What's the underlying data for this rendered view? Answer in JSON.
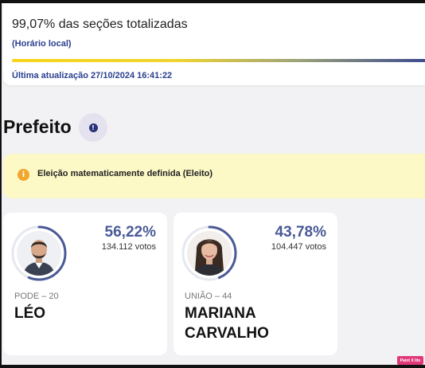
{
  "progress": {
    "title": "99,07% das seções totalizadas",
    "note": "(Horário local)",
    "percent": 99.07,
    "updated": "Última atualização 27/10/2024 16:41:22"
  },
  "section": {
    "title": "Prefeito",
    "info_icon": "info-icon",
    "info_glyph": "!"
  },
  "alert": {
    "icon": "warning-icon",
    "glyph": "i",
    "text": "Eleição matematicamente definida (Eleito)"
  },
  "candidates": [
    {
      "party": "PODE – 20",
      "name": "LÉO",
      "percent_label": "56,22%",
      "percent": 56.22,
      "votes": "134.112 votos"
    },
    {
      "party": "UNIÃO – 44",
      "name": "MARIANA CARVALHO",
      "percent_label": "43,78%",
      "percent": 43.78,
      "votes": "104.447 votos"
    }
  ],
  "watermark": "Paint X lite",
  "colors": {
    "accent_blue": "#2a3f8f",
    "percent_blue": "#4a5a97",
    "alert_bg": "#fcf9c6",
    "alert_icon": "#f2a62b",
    "bar_yellow": "#f7d51d"
  }
}
